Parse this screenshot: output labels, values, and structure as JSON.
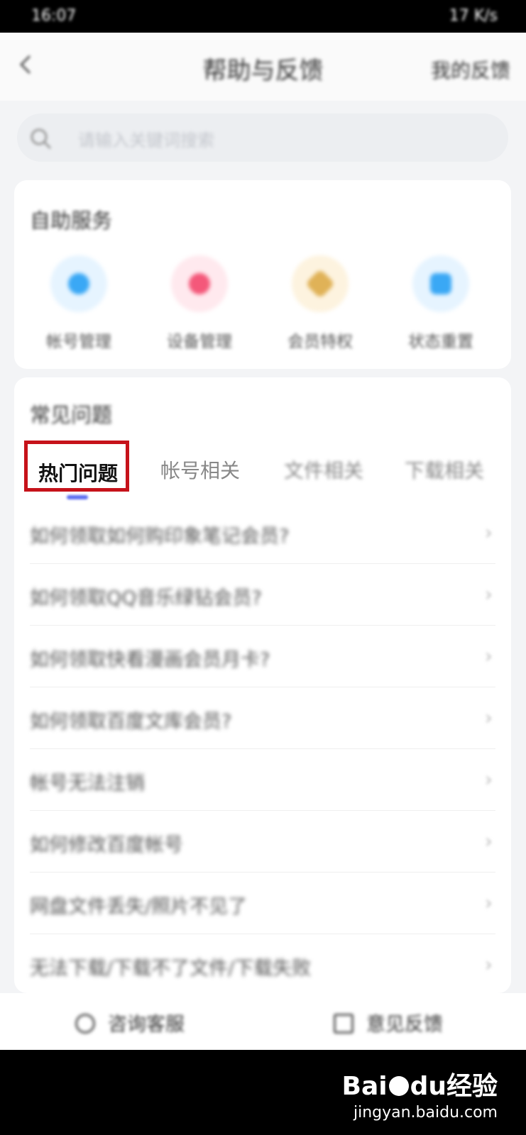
{
  "status_bar": {
    "time": "16:07",
    "right_text": "17 K/s"
  },
  "nav": {
    "title": "帮助与反馈",
    "right_action": "我的反馈"
  },
  "search": {
    "placeholder": "请输入关键词搜索"
  },
  "self_service": {
    "title": "自助服务",
    "items": [
      {
        "label": "帐号管理",
        "icon": "user-icon",
        "color": "#3aa8f5",
        "bg": "#e6f4ff"
      },
      {
        "label": "设备管理",
        "icon": "device-icon",
        "color": "#f4587a",
        "bg": "#ffe9ee"
      },
      {
        "label": "会员特权",
        "icon": "vip-diamond-icon",
        "color": "#e0b257",
        "bg": "#fdf3df"
      },
      {
        "label": "状态重置",
        "icon": "refresh-icon",
        "color": "#3aa8f5",
        "bg": "#e6f4ff"
      }
    ]
  },
  "faq": {
    "title": "常见问题",
    "tabs": [
      "热门问题",
      "帐号相关",
      "文件相关",
      "下载相关"
    ],
    "active_tab": 0,
    "questions": [
      "如何领取如何购印象笔记会员?",
      "如何领取QQ音乐绿钻会员?",
      "如何领取快看漫画会员月卡?",
      "如何领取百度文库会员?",
      "帐号无法注销",
      "如何修改百度帐号",
      "网盘文件丢失/照片不见了",
      "无法下载/下载不了文件/下载失败"
    ],
    "chevron": "›"
  },
  "bottom": {
    "left": "咨询客服",
    "right": "意见反馈"
  },
  "watermark": {
    "brand_a": "Bai",
    "brand_b": "du",
    "brand_c": "经验",
    "url": "jingyan.baidu.com"
  },
  "colors": {
    "accent": "#5b6cf0",
    "highlight": "#c6121a"
  }
}
